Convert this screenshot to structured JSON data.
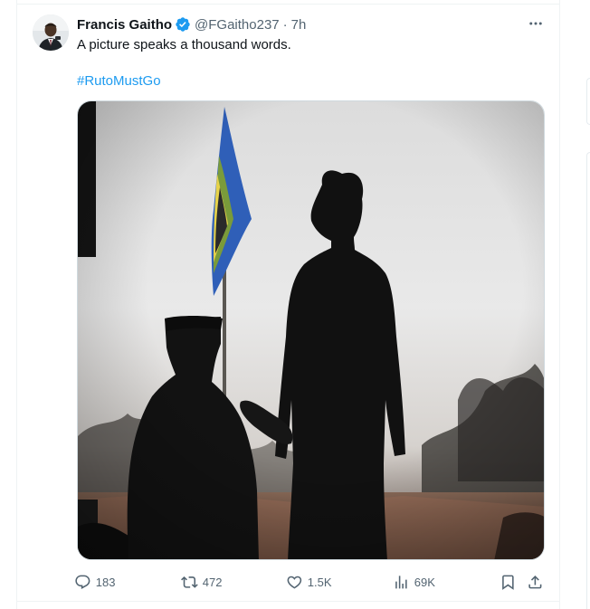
{
  "tweet": {
    "author_name": "Francis Gaitho",
    "author_handle": "@FGaitho237",
    "separator": "·",
    "time": "7h",
    "text": "A picture speaks a thousand words.",
    "hashtag": "#RutoMustGo",
    "verified": true
  },
  "actions": {
    "replies": "183",
    "retweets": "472",
    "likes": "1.5K",
    "views": "69K"
  },
  "colors": {
    "accent": "#1d9bf0",
    "text": "#0f1419",
    "muted": "#536471",
    "border": "#eff3f4"
  },
  "icons": [
    "verified-badge-icon",
    "more-icon",
    "reply-icon",
    "retweet-icon",
    "like-icon",
    "views-icon",
    "bookmark-icon",
    "share-icon"
  ]
}
